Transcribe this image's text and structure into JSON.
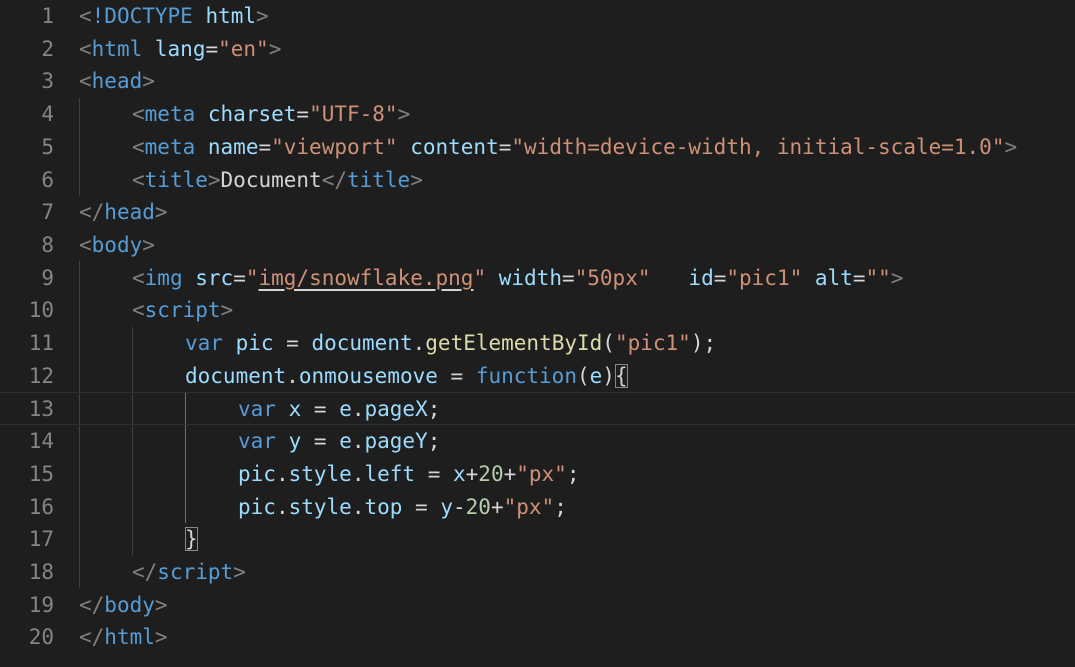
{
  "editor": {
    "current_line": 13,
    "lines": [
      {
        "number": "1",
        "indent": 0,
        "tokens": [
          {
            "t": "<",
            "c": "t-punct"
          },
          {
            "t": "!DOCTYPE",
            "c": "t-tag"
          },
          {
            "t": " ",
            "c": "t-text"
          },
          {
            "t": "html",
            "c": "t-attr"
          },
          {
            "t": ">",
            "c": "t-punct"
          }
        ]
      },
      {
        "number": "2",
        "indent": 0,
        "tokens": [
          {
            "t": "<",
            "c": "t-punct"
          },
          {
            "t": "html",
            "c": "t-tag"
          },
          {
            "t": " ",
            "c": "t-text"
          },
          {
            "t": "lang",
            "c": "t-attr"
          },
          {
            "t": "=",
            "c": "t-text"
          },
          {
            "t": "\"en\"",
            "c": "t-str"
          },
          {
            "t": ">",
            "c": "t-punct"
          }
        ]
      },
      {
        "number": "3",
        "indent": 0,
        "tokens": [
          {
            "t": "<",
            "c": "t-punct"
          },
          {
            "t": "head",
            "c": "t-tag"
          },
          {
            "t": ">",
            "c": "t-punct"
          }
        ]
      },
      {
        "number": "4",
        "indent": 1,
        "tokens": [
          {
            "t": "<",
            "c": "t-punct"
          },
          {
            "t": "meta",
            "c": "t-tag"
          },
          {
            "t": " ",
            "c": "t-text"
          },
          {
            "t": "charset",
            "c": "t-attr"
          },
          {
            "t": "=",
            "c": "t-text"
          },
          {
            "t": "\"UTF-8\"",
            "c": "t-str"
          },
          {
            "t": ">",
            "c": "t-punct"
          }
        ]
      },
      {
        "number": "5",
        "indent": 1,
        "tokens": [
          {
            "t": "<",
            "c": "t-punct"
          },
          {
            "t": "meta",
            "c": "t-tag"
          },
          {
            "t": " ",
            "c": "t-text"
          },
          {
            "t": "name",
            "c": "t-attr"
          },
          {
            "t": "=",
            "c": "t-text"
          },
          {
            "t": "\"viewport\"",
            "c": "t-str"
          },
          {
            "t": " ",
            "c": "t-text"
          },
          {
            "t": "content",
            "c": "t-attr"
          },
          {
            "t": "=",
            "c": "t-text"
          },
          {
            "t": "\"width=device-width, initial-scale=1.0\"",
            "c": "t-str"
          },
          {
            "t": ">",
            "c": "t-punct"
          }
        ]
      },
      {
        "number": "6",
        "indent": 1,
        "tokens": [
          {
            "t": "<",
            "c": "t-punct"
          },
          {
            "t": "title",
            "c": "t-tag"
          },
          {
            "t": ">",
            "c": "t-punct"
          },
          {
            "t": "Document",
            "c": "t-text"
          },
          {
            "t": "</",
            "c": "t-punct"
          },
          {
            "t": "title",
            "c": "t-tag"
          },
          {
            "t": ">",
            "c": "t-punct"
          }
        ]
      },
      {
        "number": "7",
        "indent": 0,
        "tokens": [
          {
            "t": "</",
            "c": "t-punct"
          },
          {
            "t": "head",
            "c": "t-tag"
          },
          {
            "t": ">",
            "c": "t-punct"
          }
        ]
      },
      {
        "number": "8",
        "indent": 0,
        "tokens": [
          {
            "t": "<",
            "c": "t-punct"
          },
          {
            "t": "body",
            "c": "t-tag"
          },
          {
            "t": ">",
            "c": "t-punct"
          }
        ]
      },
      {
        "number": "9",
        "indent": 1,
        "tokens": [
          {
            "t": "<",
            "c": "t-punct"
          },
          {
            "t": "img",
            "c": "t-tag"
          },
          {
            "t": " ",
            "c": "t-text"
          },
          {
            "t": "src",
            "c": "t-attr"
          },
          {
            "t": "=",
            "c": "t-text"
          },
          {
            "t": "\"",
            "c": "t-str"
          },
          {
            "t": "img/snowflake.png",
            "c": "t-str t-link"
          },
          {
            "t": "\"",
            "c": "t-str"
          },
          {
            "t": " ",
            "c": "t-text"
          },
          {
            "t": "width",
            "c": "t-attr"
          },
          {
            "t": "=",
            "c": "t-text"
          },
          {
            "t": "\"50px\"",
            "c": "t-str"
          },
          {
            "t": "   ",
            "c": "t-text"
          },
          {
            "t": "id",
            "c": "t-attr"
          },
          {
            "t": "=",
            "c": "t-text"
          },
          {
            "t": "\"pic1\"",
            "c": "t-str"
          },
          {
            "t": " ",
            "c": "t-text"
          },
          {
            "t": "alt",
            "c": "t-attr"
          },
          {
            "t": "=",
            "c": "t-text"
          },
          {
            "t": "\"\"",
            "c": "t-str"
          },
          {
            "t": ">",
            "c": "t-punct"
          }
        ]
      },
      {
        "number": "10",
        "indent": 1,
        "tokens": [
          {
            "t": "<",
            "c": "t-punct"
          },
          {
            "t": "script",
            "c": "t-tag"
          },
          {
            "t": ">",
            "c": "t-punct"
          }
        ]
      },
      {
        "number": "11",
        "indent": 2,
        "tokens": [
          {
            "t": "var",
            "c": "t-kw"
          },
          {
            "t": " ",
            "c": "t-text"
          },
          {
            "t": "pic",
            "c": "t-var"
          },
          {
            "t": " = ",
            "c": "t-op"
          },
          {
            "t": "document",
            "c": "t-var"
          },
          {
            "t": ".",
            "c": "t-op"
          },
          {
            "t": "getElementById",
            "c": "t-fn"
          },
          {
            "t": "(",
            "c": "t-op"
          },
          {
            "t": "\"pic1\"",
            "c": "t-str"
          },
          {
            "t": ");",
            "c": "t-op"
          }
        ]
      },
      {
        "number": "12",
        "indent": 2,
        "tokens": [
          {
            "t": "document",
            "c": "t-var"
          },
          {
            "t": ".",
            "c": "t-op"
          },
          {
            "t": "onmousemove",
            "c": "t-var"
          },
          {
            "t": " = ",
            "c": "t-op"
          },
          {
            "t": "function",
            "c": "t-kw"
          },
          {
            "t": "(",
            "c": "t-op"
          },
          {
            "t": "e",
            "c": "t-var"
          },
          {
            "t": ")",
            "c": "t-op"
          },
          {
            "t": "{",
            "c": "t-op t-bracket"
          }
        ]
      },
      {
        "number": "13",
        "indent": 3,
        "tokens": [
          {
            "t": "var",
            "c": "t-kw"
          },
          {
            "t": " ",
            "c": "t-text"
          },
          {
            "t": "x",
            "c": "t-var"
          },
          {
            "t": " = ",
            "c": "t-op"
          },
          {
            "t": "e",
            "c": "t-var"
          },
          {
            "t": ".",
            "c": "t-op"
          },
          {
            "t": "pageX",
            "c": "t-var"
          },
          {
            "t": ";",
            "c": "t-op"
          }
        ]
      },
      {
        "number": "14",
        "indent": 3,
        "tokens": [
          {
            "t": "var",
            "c": "t-kw"
          },
          {
            "t": " ",
            "c": "t-text"
          },
          {
            "t": "y",
            "c": "t-var"
          },
          {
            "t": " = ",
            "c": "t-op"
          },
          {
            "t": "e",
            "c": "t-var"
          },
          {
            "t": ".",
            "c": "t-op"
          },
          {
            "t": "pageY",
            "c": "t-var"
          },
          {
            "t": ";",
            "c": "t-op"
          }
        ]
      },
      {
        "number": "15",
        "indent": 3,
        "tokens": [
          {
            "t": "pic",
            "c": "t-var"
          },
          {
            "t": ".",
            "c": "t-op"
          },
          {
            "t": "style",
            "c": "t-var"
          },
          {
            "t": ".",
            "c": "t-op"
          },
          {
            "t": "left",
            "c": "t-var"
          },
          {
            "t": " = ",
            "c": "t-op"
          },
          {
            "t": "x",
            "c": "t-var"
          },
          {
            "t": "+",
            "c": "t-op"
          },
          {
            "t": "20",
            "c": "t-num"
          },
          {
            "t": "+",
            "c": "t-op"
          },
          {
            "t": "\"px\"",
            "c": "t-str"
          },
          {
            "t": ";",
            "c": "t-op"
          }
        ]
      },
      {
        "number": "16",
        "indent": 3,
        "tokens": [
          {
            "t": "pic",
            "c": "t-var"
          },
          {
            "t": ".",
            "c": "t-op"
          },
          {
            "t": "style",
            "c": "t-var"
          },
          {
            "t": ".",
            "c": "t-op"
          },
          {
            "t": "top",
            "c": "t-var"
          },
          {
            "t": " = ",
            "c": "t-op"
          },
          {
            "t": "y",
            "c": "t-var"
          },
          {
            "t": "-",
            "c": "t-op"
          },
          {
            "t": "20",
            "c": "t-num"
          },
          {
            "t": "+",
            "c": "t-op"
          },
          {
            "t": "\"px\"",
            "c": "t-str"
          },
          {
            "t": ";",
            "c": "t-op"
          }
        ]
      },
      {
        "number": "17",
        "indent": 2,
        "tokens": [
          {
            "t": "}",
            "c": "t-op t-bracket"
          }
        ]
      },
      {
        "number": "18",
        "indent": 1,
        "tokens": [
          {
            "t": "</",
            "c": "t-punct"
          },
          {
            "t": "script",
            "c": "t-tag"
          },
          {
            "t": ">",
            "c": "t-punct"
          }
        ]
      },
      {
        "number": "19",
        "indent": 0,
        "tokens": [
          {
            "t": "</",
            "c": "t-punct"
          },
          {
            "t": "body",
            "c": "t-tag"
          },
          {
            "t": ">",
            "c": "t-punct"
          }
        ]
      },
      {
        "number": "20",
        "indent": 0,
        "tokens": [
          {
            "t": "</",
            "c": "t-punct"
          },
          {
            "t": "html",
            "c": "t-tag"
          },
          {
            "t": ">",
            "c": "t-punct"
          }
        ]
      }
    ]
  },
  "colors": {
    "background": "#1e1e1e",
    "line_number": "#858585",
    "tag": "#569cd6",
    "attribute": "#9cdcfe",
    "string": "#ce9178",
    "function": "#dcdcaa",
    "number": "#b5cea8"
  }
}
